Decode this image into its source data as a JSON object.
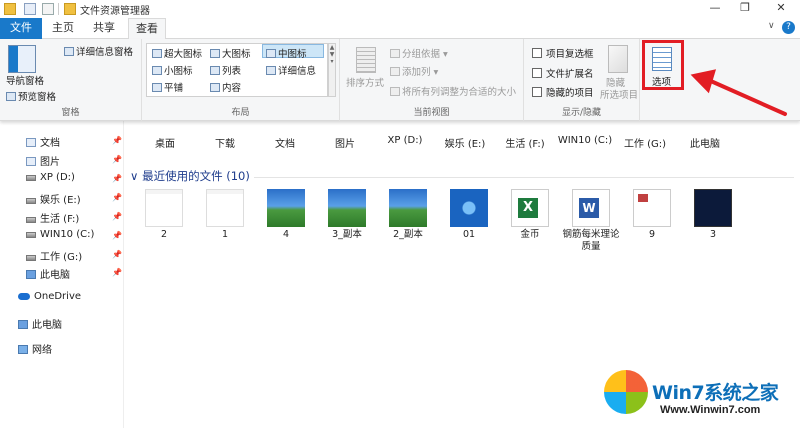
{
  "window": {
    "title": "文件资源管理器",
    "minimize": "—",
    "maximize": "❐",
    "close": "✕",
    "ribbon_toggle": "∨",
    "help": "?"
  },
  "tabs": {
    "file": "文件",
    "home": "主页",
    "share": "共享",
    "view": "查看"
  },
  "ribbon": {
    "panes": {
      "nav_pane": "导航窗格",
      "preview_pane": "预览窗格",
      "details_pane": "详细信息窗格",
      "label": "窗格"
    },
    "layout": {
      "extra_large": "超大图标",
      "large": "大图标",
      "medium": "中图标",
      "small": "小图标",
      "list": "列表",
      "details": "详细信息",
      "tiles": "平铺",
      "content": "内容",
      "label": "布局"
    },
    "current_view": {
      "sort_by": "排序方式",
      "group_by": "分组依据",
      "add_columns": "添加列",
      "fit_columns": "将所有列调整为合适的大小",
      "label": "当前视图"
    },
    "show_hide": {
      "item_checkboxes": "项目复选框",
      "file_extensions": "文件扩展名",
      "hidden_items": "隐藏的项目",
      "hide_selected_1": "隐藏",
      "hide_selected_2": "所选项目",
      "label": "显示/隐藏"
    },
    "options": "选项"
  },
  "sidebar": {
    "items": [
      {
        "label": "文档",
        "icon": "document-icon",
        "pinned": true
      },
      {
        "label": "图片",
        "icon": "picture-icon",
        "pinned": true
      },
      {
        "label": "XP (D:)",
        "icon": "drive-icon",
        "pinned": true
      },
      {
        "label": "娱乐 (E:)",
        "icon": "drive-icon",
        "pinned": true
      },
      {
        "label": "生活 (F:)",
        "icon": "drive-icon",
        "pinned": true
      },
      {
        "label": "WIN10 (C:)",
        "icon": "drive-icon",
        "pinned": true
      },
      {
        "label": "工作 (G:)",
        "icon": "drive-icon",
        "pinned": true
      },
      {
        "label": "此电脑",
        "icon": "computer-icon",
        "pinned": true
      }
    ],
    "onedrive": "OneDrive",
    "this_pc": "此电脑",
    "network": "网络",
    "pin_glyph": "📌"
  },
  "frequent": [
    {
      "label": "桌面"
    },
    {
      "label": "下载"
    },
    {
      "label": "文档"
    },
    {
      "label": "图片"
    },
    {
      "label": "XP (D:)"
    },
    {
      "label": "娱乐 (E:)"
    },
    {
      "label": "生活 (F:)"
    },
    {
      "label": "WIN10 (C:)"
    },
    {
      "label": "工作 (G:)"
    },
    {
      "label": "此电脑"
    }
  ],
  "recent": {
    "title": "最近使用的文件 (10)",
    "files": [
      {
        "label": "2",
        "kind": "doc"
      },
      {
        "label": "1",
        "kind": "doc"
      },
      {
        "label": "4",
        "kind": "landscape"
      },
      {
        "label": "3_副本",
        "kind": "landscape"
      },
      {
        "label": "2_副本",
        "kind": "landscape"
      },
      {
        "label": "01",
        "kind": "windows"
      },
      {
        "label": "金币",
        "kind": "excel"
      },
      {
        "label": "钢筋每米理论质量",
        "kind": "word"
      },
      {
        "label": "9",
        "kind": "page"
      },
      {
        "label": "3",
        "kind": "dark"
      }
    ]
  },
  "watermark": {
    "title": "Win7系统之家",
    "url": "Www.Winwin7.com"
  },
  "colors": {
    "accent": "#1979ca",
    "highlight": "#e21d24",
    "section_title": "#1e3c8c"
  }
}
